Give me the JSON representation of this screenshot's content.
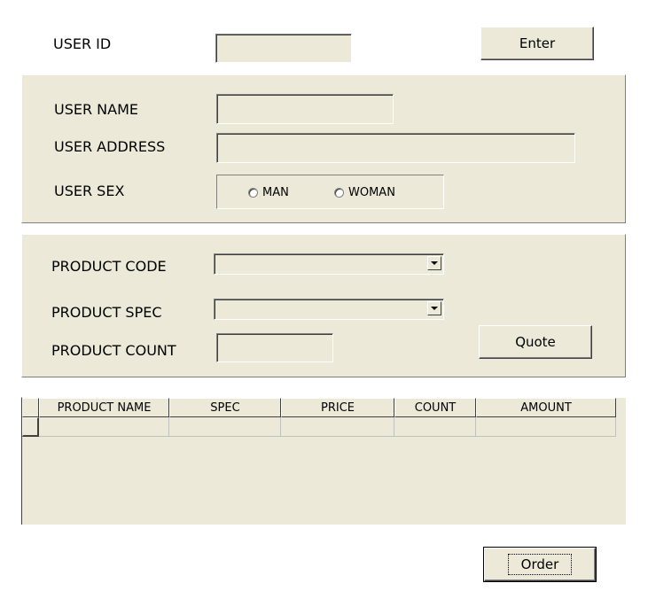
{
  "user": {
    "id_label": "USER ID",
    "id_value": "",
    "enter_button": "Enter",
    "name_label": "USER NAME",
    "name_value": "",
    "address_label": "USER ADDRESS",
    "address_value": "",
    "sex_label": "USER SEX",
    "sex_options": [
      "MAN",
      "WOMAN"
    ]
  },
  "product": {
    "code_label": "PRODUCT CODE",
    "code_value": "",
    "spec_label": "PRODUCT SPEC",
    "spec_value": "",
    "count_label": "PRODUCT COUNT",
    "count_value": "",
    "quote_button": "Quote"
  },
  "grid": {
    "columns": [
      "PRODUCT NAME",
      "SPEC",
      "PRICE",
      "COUNT",
      "AMOUNT"
    ],
    "rows": [
      [
        "",
        "",
        "",
        "",
        ""
      ]
    ]
  },
  "order_button": "Order"
}
